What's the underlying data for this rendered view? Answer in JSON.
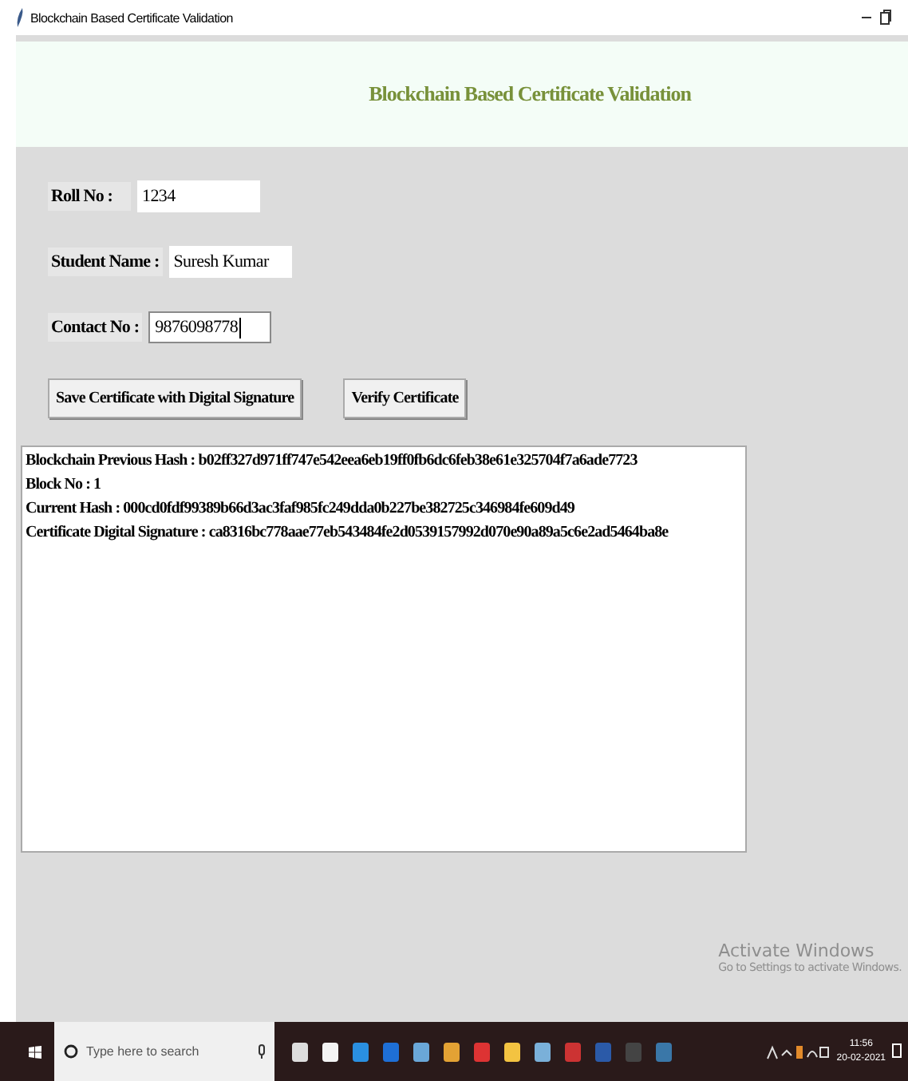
{
  "window": {
    "title": "Blockchain Based Certificate Validation"
  },
  "header": {
    "title": "Blockchain Based Certificate Validation"
  },
  "form": {
    "fields": [
      {
        "label": "Roll No :",
        "value": "1234",
        "focused": false
      },
      {
        "label": "Student Name :",
        "value": "Suresh Kumar",
        "focused": false
      },
      {
        "label": "Contact No :",
        "value": "9876098778",
        "focused": true
      }
    ]
  },
  "buttons": [
    "Save Certificate with Digital Signature",
    "Verify Certificate"
  ],
  "output": {
    "lines": [
      "Blockchain Previous Hash : b02ff327d971ff747e542eea6eb19ff0fb6dc6feb38e61e325704f7a6ade7723",
      "Block No : 1",
      "Current Hash : 000cd0fdf99389b66d3ac3faf985fc249dda0b227be382725c346984fe609d49",
      "Certificate Digital Signature : ca8316bc778aae77eb543484fe2d0539157992d070e90a89a5c6e2ad5464ba8e"
    ]
  },
  "watermark": {
    "title": "Activate Windows",
    "subtitle": "Go to Settings to activate Windows."
  },
  "taskbar": {
    "search": {
      "placeholder": "Type here to search"
    },
    "time": "11:56",
    "date": "20-02-2021"
  }
}
